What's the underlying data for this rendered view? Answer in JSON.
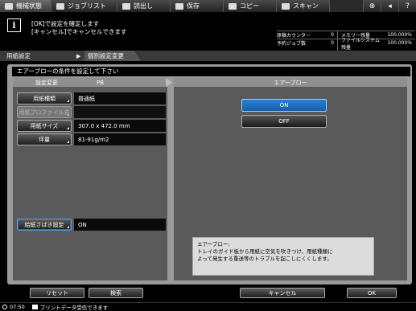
{
  "topbar": {
    "tabs": [
      {
        "label": "機械状態",
        "icon": "machine-status-icon"
      },
      {
        "label": "ジョブリスト",
        "icon": "job-list-icon"
      },
      {
        "label": "読出し",
        "icon": "recall-icon"
      },
      {
        "label": "保存",
        "icon": "store-icon"
      },
      {
        "label": "コピー",
        "icon": "copy-icon"
      },
      {
        "label": "スキャン",
        "icon": "scan-icon"
      }
    ],
    "icons": [
      {
        "name": "globe-icon",
        "glyph": "⊕"
      },
      {
        "name": "speaker-icon",
        "glyph": "◂"
      },
      {
        "name": "help-icon",
        "glyph": "?"
      }
    ]
  },
  "message": {
    "line1": "[OK]で設定を確定します",
    "line2": "[キャンセル]でキャンセルできます"
  },
  "counters": {
    "row1": {
      "k1": "原稿カウンター",
      "v1": "0",
      "k2": "メモリー残量",
      "v2": "100.000%"
    },
    "row2": {
      "k1": "予約ジョブ数",
      "v1": "0",
      "k2": "ファイルシステム残量",
      "v2": "100.000%"
    }
  },
  "breadcrumb": {
    "item1": "用紙設定",
    "item2": "個別設定変更"
  },
  "panel": {
    "title": "エアーブローの条件を設定して下さい",
    "left_header": "設定変更",
    "left_header_tray": "PB",
    "right_header": "エアーブロー"
  },
  "fields": {
    "paper_type": {
      "label": "用紙種類",
      "value": "普通紙"
    },
    "paper_profile": {
      "label": "用紙プロファイル名",
      "value": ""
    },
    "paper_size": {
      "label": "用紙サイズ",
      "value": "307.0 x 472.0 mm"
    },
    "weight": {
      "label": "坪量",
      "value": "81-91g/m2"
    },
    "feed_assist": {
      "label": "給紙さばき設定",
      "value": "ON"
    }
  },
  "options": {
    "on": "ON",
    "off": "OFF",
    "selected": "ON"
  },
  "description": {
    "line1": "エアーブロー:",
    "line2": "トレイのガイド板から用紙に空気を吹きつけ、用紙種類に",
    "line3": "よって発生する重送等のトラブルを起こしにくくします。"
  },
  "bottom": {
    "reset": "リセット",
    "search": "検索",
    "cancel": "キャンセル",
    "ok": "OK"
  },
  "status": {
    "time": "07:50",
    "text": "プリントデータ受信できます"
  },
  "colors": {
    "selected_blue": "#2d7fd6",
    "panel_gray": "#9a9a9a",
    "section_gray": "#5a5a5a"
  }
}
